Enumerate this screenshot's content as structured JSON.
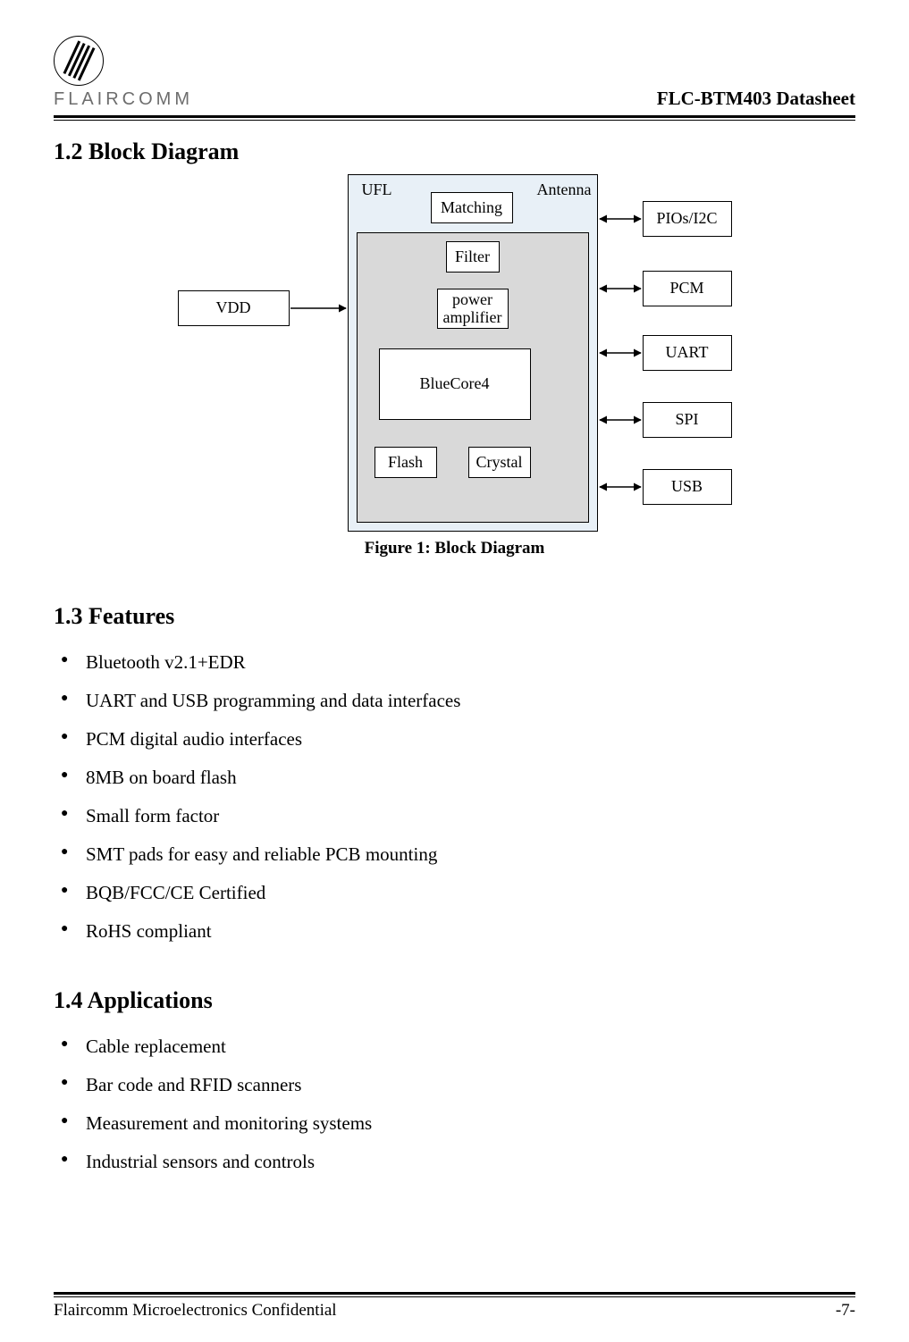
{
  "header": {
    "brand": "FLAIRCOMM",
    "doc_title": "FLC-BTM403 Datasheet"
  },
  "sections": {
    "block_diagram_heading": "1.2  Block Diagram",
    "features_heading": "1.3  Features",
    "applications_heading": "1.4  Applications"
  },
  "diagram": {
    "ufl": "UFL",
    "antenna": "Antenna",
    "matching": "Matching",
    "filter": "Filter",
    "power_amp": "power amplifier",
    "bluecore": "BlueCore4",
    "flash": "Flash",
    "crystal": "Crystal",
    "vdd": "VDD",
    "pios": "PIOs/I2C",
    "pcm": "PCM",
    "uart": "UART",
    "spi": "SPI",
    "usb": "USB",
    "caption": "Figure 1: Block Diagram"
  },
  "features": [
    "Bluetooth v2.1+EDR",
    "UART and USB programming and data interfaces",
    "PCM  digital audio interfaces",
    "8MB on board flash",
    "Small form factor",
    "SMT pads for easy and reliable PCB mounting",
    "BQB/FCC/CE Certified",
    "RoHS compliant"
  ],
  "applications": [
    "Cable replacement",
    "Bar code and RFID scanners",
    "Measurement and monitoring systems",
    "Industrial sensors and controls"
  ],
  "footer": {
    "left": "Flaircomm Microelectronics Confidential",
    "right": "-7-"
  }
}
